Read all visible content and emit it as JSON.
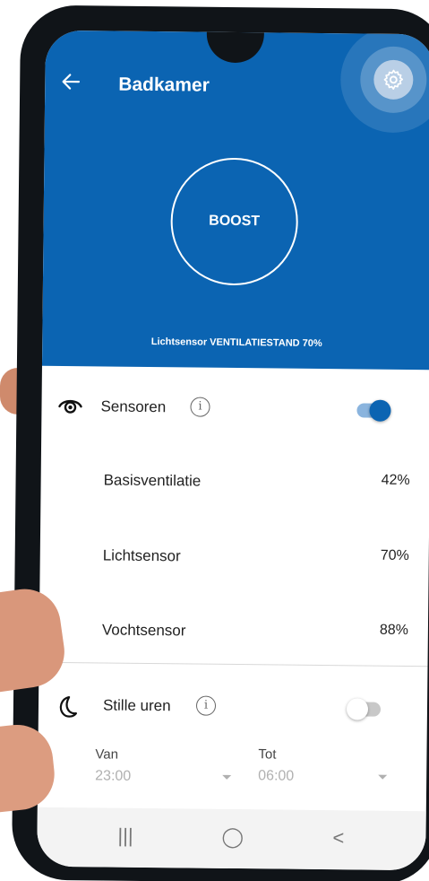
{
  "header": {
    "title": "Badkamer"
  },
  "boost": {
    "label": "BOOST"
  },
  "status": {
    "text": "Lichtsensor VENTILATIESTAND 70%"
  },
  "sensors": {
    "label": "Sensoren",
    "info": "i",
    "enabled": true,
    "items": [
      {
        "label": "Basisventilatie",
        "value": "42%"
      },
      {
        "label": "Lichtsensor",
        "value": "70%"
      },
      {
        "label": "Vochtsensor",
        "value": "88%"
      }
    ]
  },
  "quiet_hours": {
    "label": "Stille uren",
    "info": "i",
    "enabled": false,
    "from_label": "Van",
    "from_value": "23:00",
    "to_label": "Tot",
    "to_value": "06:00"
  },
  "colors": {
    "primary": "#0b64b2",
    "toggle_on_thumb": "#0b64b2",
    "toggle_on_track": "#8ab4de",
    "toggle_off_thumb": "#ffffff",
    "toggle_off_track": "#c8c8c8"
  },
  "icons": {
    "back": "arrow-left-icon",
    "settings": "gear-icon",
    "sensors": "eye-icon",
    "quiet": "moon-icon"
  },
  "navbar": {
    "recent": "|||",
    "home": "◯",
    "back": "<"
  }
}
